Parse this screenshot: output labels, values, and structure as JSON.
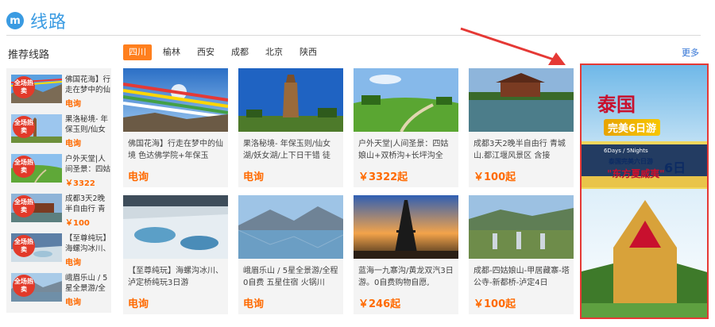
{
  "header": {
    "logo_glyph": "m",
    "title": "线路"
  },
  "sidebar": {
    "title": "推荐线路",
    "badge_text": "全场热卖",
    "items": [
      {
        "text": "佛国花海】行走在梦中的仙",
        "price": "电询"
      },
      {
        "text": "果洛秘境- 年保玉则/仙女",
        "price": "电询"
      },
      {
        "text": "户外天堂|人间圣景：四姑",
        "price": "￥3322"
      },
      {
        "text": "成都3天2晚半自由行 青",
        "price": "￥100"
      },
      {
        "text": "【至尊纯玩】海螺沟冰川、",
        "price": "电询"
      },
      {
        "text": "峨眉乐山 / 5星全景游/全",
        "price": "电询"
      }
    ]
  },
  "tabs": [
    "四川",
    "榆林",
    "西安",
    "成都",
    "北京",
    "陕西"
  ],
  "more": "更多",
  "cards": [
    {
      "title": "佛国花海】行走在梦中的仙境 色达佛学院+年保玉",
      "price": "电询",
      "icon": "prayer-flags-image"
    },
    {
      "title": "果洛秘境- 年保玉则/仙女湖/妖女湖/上下日干错 徒",
      "price": "电询",
      "icon": "pagoda-image"
    },
    {
      "title": "户外天堂|人间圣景：四姑娘山+双桥沟+长坪沟全",
      "price": "￥3322起",
      "icon": "meadow-image"
    },
    {
      "title": "成都3天2晚半自由行 青城山.都江堰风景区 含接",
      "price": "￥100起",
      "icon": "palace-image"
    },
    {
      "title": "【至尊纯玩】海螺沟冰川、泸定桥纯玩3日游",
      "price": "电询",
      "icon": "hot-spring-image"
    },
    {
      "title": "峨眉乐山 / 5星全景游/全程0自费 五星住宿 火锅川",
      "price": "电询",
      "icon": "lake-mountain-image"
    },
    {
      "title": "蓝海一九寨沟/黄龙双汽3日游。0自费购物自愿,",
      "price": "￥246起",
      "icon": "eiffel-tower-image"
    },
    {
      "title": "成都-四姑娘山-甲居藏寨-塔公寺-新都桥-泸定4日",
      "price": "￥100起",
      "icon": "garden-image"
    }
  ],
  "ad": {
    "title": "泰国",
    "subtitle": "完美6日游",
    "days": "6Days / 5Nights",
    "line3": "泰国完美六日游",
    "line4": "\"东方夏威夷\"",
    "six": "6日"
  },
  "colors": {
    "accent": "#ff7f1d",
    "brand": "#3a9be2",
    "price": "#ff6a00",
    "highlight": "#e53935"
  }
}
